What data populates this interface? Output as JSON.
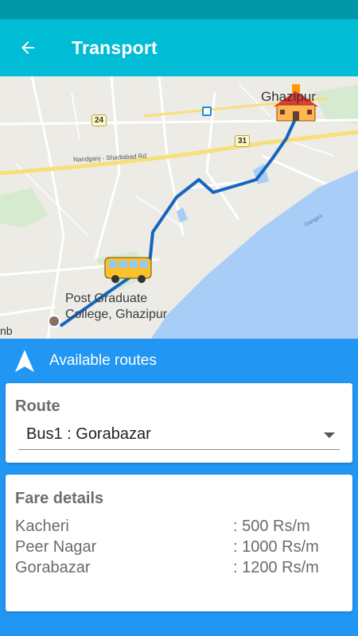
{
  "app_bar": {
    "title": "Transport",
    "back_icon": "arrow-left-icon"
  },
  "map": {
    "city_label": "Ghazipur",
    "poi_label_line1": "Post Graduate",
    "poi_label_line2": "College, Ghazipur",
    "edge_label": "nb",
    "road_label": "Nandganj - Shadiabad Rd",
    "river_label": "Ganges",
    "highway_badges": [
      "24",
      "31"
    ],
    "route_color": "#1565c0",
    "river_color": "#a8cdf7"
  },
  "routes_header": {
    "label": "Available routes",
    "icon": "navigation-arrow-icon"
  },
  "route_card": {
    "title": "Route",
    "selected_route": "Bus1 : Gorabazar"
  },
  "fare_card": {
    "title": "Fare details",
    "rows": [
      {
        "stop": "Kacheri",
        "price": ": 500 Rs/m"
      },
      {
        "stop": "Peer Nagar",
        "price": ": 1000 Rs/m"
      },
      {
        "stop": "Gorabazar",
        "price": ": 1200 Rs/m"
      }
    ]
  },
  "colors": {
    "status_bar": "#0097a7",
    "app_bar": "#00bcd4",
    "background": "#2196f3"
  }
}
